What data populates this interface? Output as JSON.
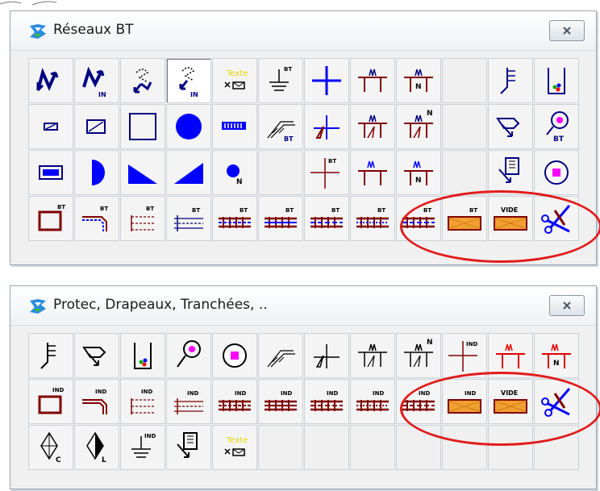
{
  "palette_bt": {
    "title": "Réseaux BT",
    "texte_label": "Texte",
    "bt_label": "BT",
    "in_label": "IN",
    "n_label": "N",
    "vide_label": "VIDE"
  },
  "palette_protec": {
    "title": "Protec, Drapeaux, Tranchées, ..",
    "ind_label": "IND",
    "vide_label": "VIDE",
    "texte_label": "Texte",
    "c_label": "C",
    "l_label": "L",
    "n_label": "N"
  },
  "colors": {
    "highlight": "#e11b1b",
    "navy": "#000080",
    "blue": "#0000ff",
    "maroon": "#800000",
    "orange": "#f0a030",
    "magenta": "#ff00ff",
    "yellow_text": "#e8d400"
  },
  "icons": {
    "app": "network-palette-icon",
    "close": "close-icon"
  }
}
